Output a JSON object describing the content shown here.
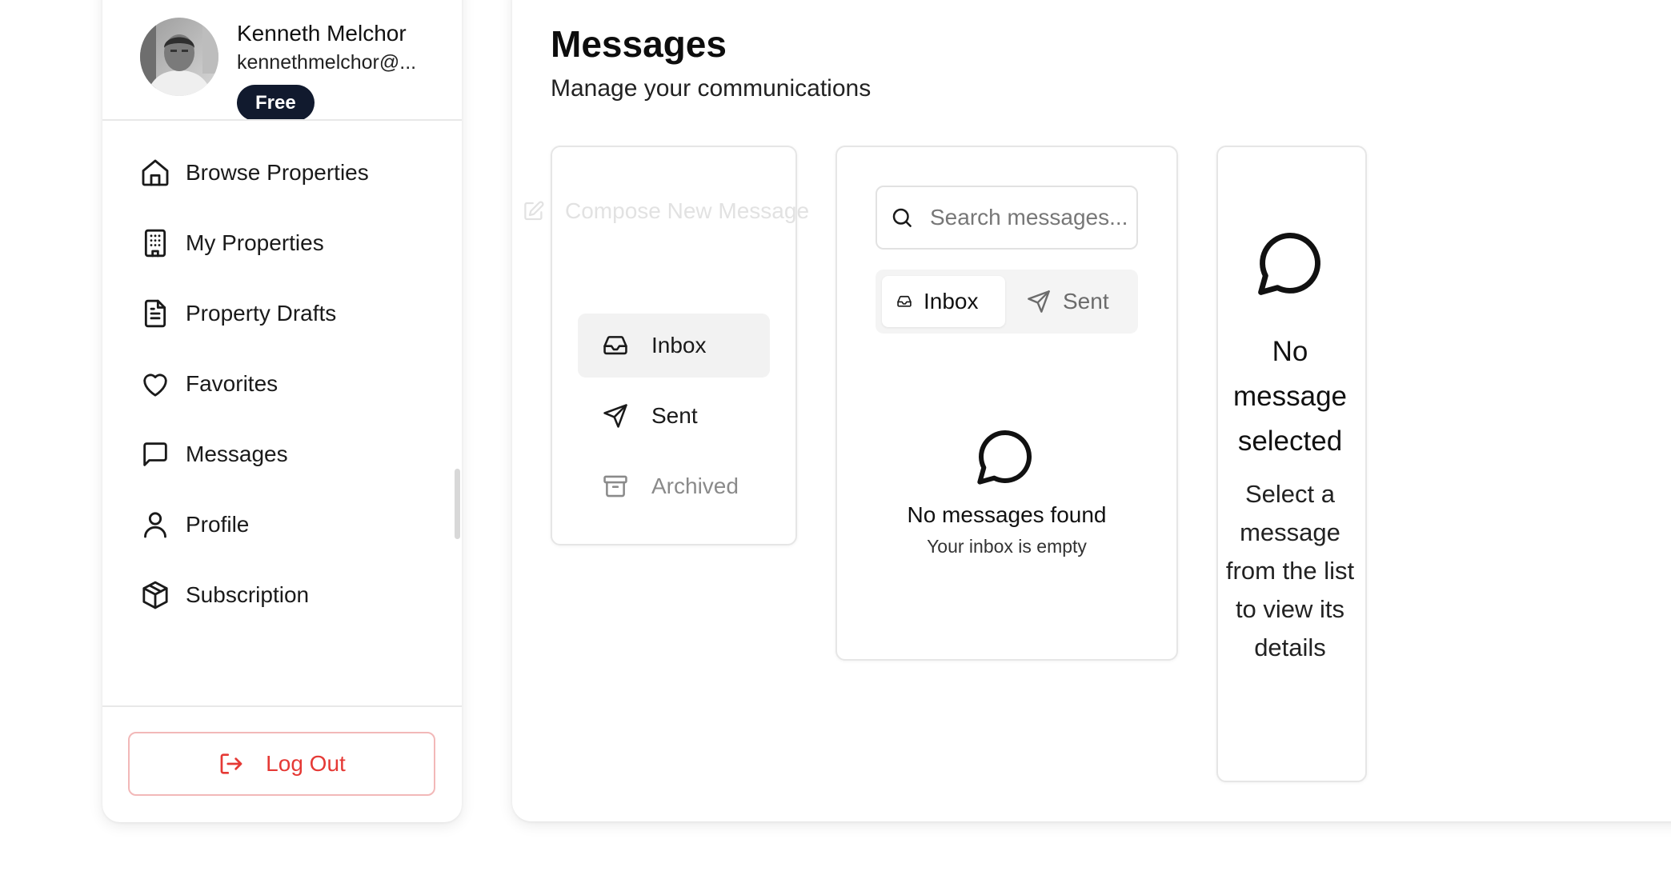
{
  "user": {
    "name": "Kenneth Melchor",
    "email": "kennethmelchor@...",
    "plan_badge": "Free"
  },
  "sidebar": {
    "items": [
      {
        "label": "Browse Properties",
        "icon": "home-icon"
      },
      {
        "label": "My Properties",
        "icon": "building-icon"
      },
      {
        "label": "Property Drafts",
        "icon": "file-text-icon"
      },
      {
        "label": "Favorites",
        "icon": "heart-icon"
      },
      {
        "label": "Messages",
        "icon": "message-circle-icon"
      },
      {
        "label": "Profile",
        "icon": "user-icon"
      },
      {
        "label": "Subscription",
        "icon": "package-icon"
      }
    ],
    "logout_label": "Log Out"
  },
  "page": {
    "title": "Messages",
    "subtitle": "Manage your communications"
  },
  "folders": {
    "compose_label": "Compose New Message",
    "items": [
      {
        "label": "Inbox",
        "icon": "inbox-icon",
        "active": true
      },
      {
        "label": "Sent",
        "icon": "send-icon",
        "active": false
      },
      {
        "label": "Archived",
        "icon": "archive-icon",
        "active": false
      }
    ]
  },
  "message_list": {
    "search_placeholder": "Search messages...",
    "tabs": [
      {
        "label": "Inbox",
        "icon": "inbox-icon",
        "active": true
      },
      {
        "label": "Sent",
        "icon": "send-icon",
        "active": false
      }
    ],
    "empty_title": "No messages found",
    "empty_subtitle": "Your inbox is empty"
  },
  "detail": {
    "empty_title": "No message selected",
    "empty_subtitle": "Select a message from the list to view its details"
  },
  "colors": {
    "badge_bg": "#111a2e",
    "logout": "#e53935",
    "active_bg": "#f2f2f2"
  }
}
